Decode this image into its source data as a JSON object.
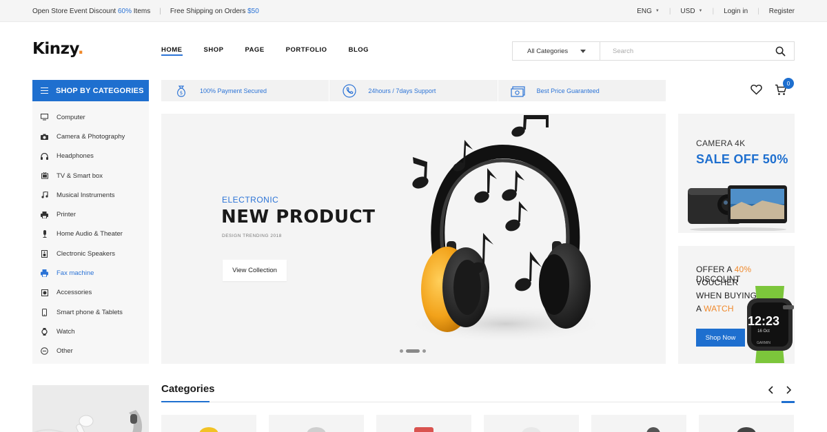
{
  "topbar": {
    "promo1_prefix": "Open Store Event Discount ",
    "promo1_value": "60%",
    "promo1_suffix": " Items",
    "promo2_prefix": "Free Shipping on Orders ",
    "promo2_value": "$50",
    "language": "ENG",
    "currency": "USD",
    "login": "Login in",
    "register": "Register"
  },
  "header": {
    "logo": "Kinzy",
    "logo_dot": ".",
    "nav": [
      "HOME",
      "SHOP",
      "PAGE",
      "PORTFOLIO",
      "BLOG"
    ],
    "active_nav": "HOME",
    "search_category": "All Categories",
    "search_placeholder": "Search",
    "cart_count": "0"
  },
  "sidebar": {
    "title": "SHOP BY CATEGORIES",
    "items": [
      {
        "label": "Computer",
        "icon": "monitor-icon"
      },
      {
        "label": "Camera & Photography",
        "icon": "camera-icon"
      },
      {
        "label": "Headphones",
        "icon": "headphones-icon"
      },
      {
        "label": "TV & Smart box",
        "icon": "tv-icon"
      },
      {
        "label": "Musical Instruments",
        "icon": "music-note-icon"
      },
      {
        "label": "Printer",
        "icon": "printer-icon"
      },
      {
        "label": "Home Audio & Theater",
        "icon": "microphone-icon"
      },
      {
        "label": "Clectronic Speakers",
        "icon": "speaker-icon"
      },
      {
        "label": "Fax machine",
        "icon": "fax-icon"
      },
      {
        "label": "Accessories",
        "icon": "accessories-icon"
      },
      {
        "label": "Smart phone & Tablets",
        "icon": "smartphone-icon"
      },
      {
        "label": "Watch",
        "icon": "watch-icon"
      },
      {
        "label": "Other",
        "icon": "other-icon"
      }
    ],
    "active_item": "Fax machine"
  },
  "features": [
    {
      "label": "100% Payment Secured",
      "icon": "money-bag-icon"
    },
    {
      "label": "24hours / 7days Support",
      "icon": "phone-icon"
    },
    {
      "label": "Best Price Guaranteed",
      "icon": "cash-icon"
    }
  ],
  "hero": {
    "tag": "ELECTRONIC",
    "title": "NEW PRODUCT",
    "subtitle": "DESIGN TRENDING 2018",
    "button": "View Collection"
  },
  "promo_camera": {
    "line1": "CAMERA 4K",
    "line2": "SALE OFF 50%"
  },
  "promo_watch": {
    "line1_prefix": "OFFER A ",
    "line1_value": "40%",
    "line1_suffix": " DISCOUNT",
    "line2": "VOUCHER",
    "line3": "WHEN BUYING",
    "line4_prefix": "A ",
    "line4_value": "WATCH",
    "watch_time": "12:23",
    "watch_date": "16 Oct",
    "watch_brand": "GARMIN",
    "button": "Shop Now"
  },
  "categories_section": {
    "title": "Categories"
  },
  "colors": {
    "accent": "#1e6fcf",
    "link": "#2b73d6",
    "highlight": "#f0892b"
  }
}
